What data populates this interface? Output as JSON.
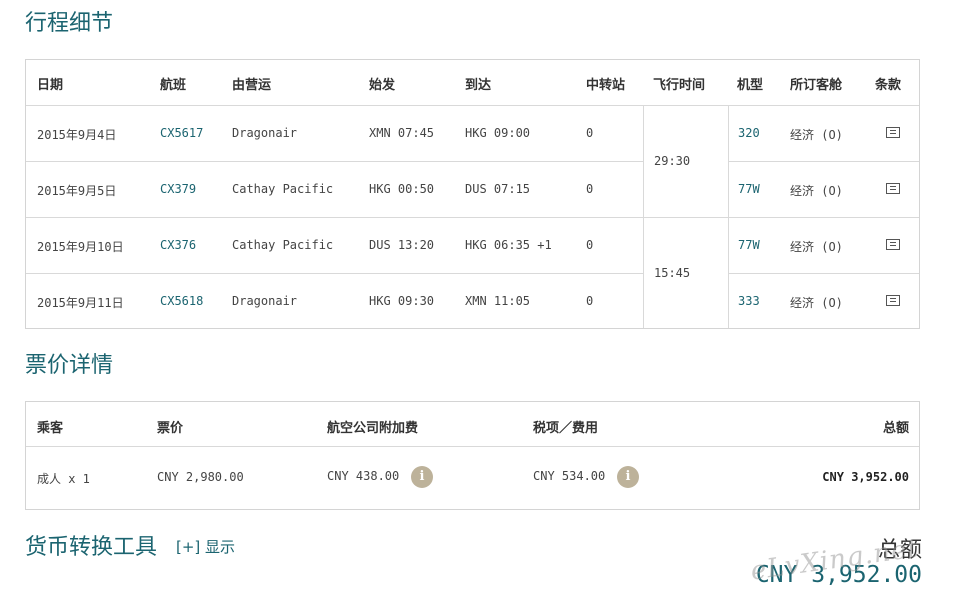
{
  "itinerary": {
    "title": "行程细节",
    "headers": [
      "日期",
      "航班",
      "由营运",
      "始发",
      "到达",
      "中转站",
      "飞行时间",
      "机型",
      "所订客舱",
      "条款"
    ],
    "rows": [
      {
        "date": "2015年9月4日",
        "flight": "CX5617",
        "operator": "Dragonair",
        "depart": "XMN 07:45",
        "arrive": "HKG 09:00",
        "stops": "0",
        "aircraft": "320",
        "cabin": "经济 (O)",
        "terms_icon": "document-icon"
      },
      {
        "date": "2015年9月5日",
        "flight": "CX379",
        "operator": "Cathay Pacific",
        "depart": "HKG 00:50",
        "arrive": "DUS 07:15",
        "stops": "0",
        "aircraft": "77W",
        "cabin": "经济 (O)",
        "terms_icon": "document-icon"
      },
      {
        "date": "2015年9月10日",
        "flight": "CX376",
        "operator": "Cathay Pacific",
        "depart": "DUS 13:20",
        "arrive": "HKG 06:35 +1",
        "stops": "0",
        "aircraft": "77W",
        "cabin": "经济 (O)",
        "terms_icon": "document-icon"
      },
      {
        "date": "2015年9月11日",
        "flight": "CX5618",
        "operator": "Dragonair",
        "depart": "HKG 09:30",
        "arrive": "XMN 11:05",
        "stops": "0",
        "aircraft": "333",
        "cabin": "经济 (O)",
        "terms_icon": "document-icon"
      }
    ],
    "durations": [
      "29:30",
      "15:45"
    ]
  },
  "fare": {
    "title": "票价详情",
    "headers": [
      "乘客",
      "票价",
      "航空公司附加费",
      "税项／费用",
      "总额"
    ],
    "row": {
      "passenger": "成人 x 1",
      "fare": "CNY 2,980.00",
      "surcharge": "CNY 438.00",
      "taxes": "CNY 534.00",
      "total": "CNY 3,952.00",
      "info_icon_glyph": "i"
    }
  },
  "currency": {
    "title": "货币转换工具",
    "toggle_label": "[+] 显示"
  },
  "grand_total": {
    "label": "总额",
    "amount": "CNY 3,952.00"
  },
  "watermark": "eLvXing.net",
  "colors": {
    "accent": "#1b6470",
    "border": "#d4d4d4",
    "info_badge": "#bdb29a"
  }
}
